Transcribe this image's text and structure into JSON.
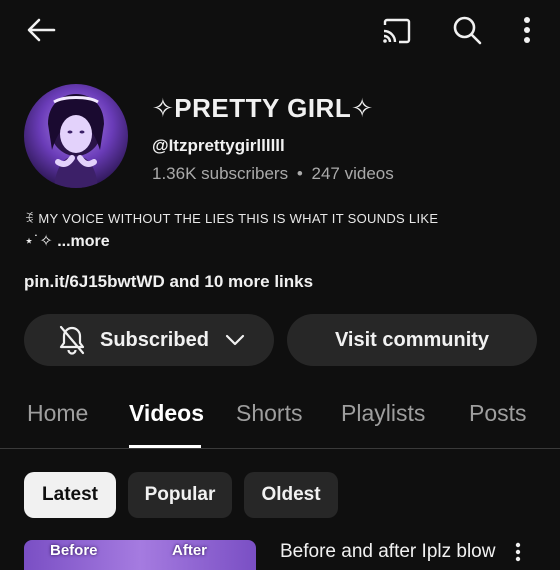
{
  "channel": {
    "name": "✧PRETTY GIRL✧",
    "handle": "@Itzprettygirllllll",
    "subscribers": "1.36K subscribers",
    "separator": "•",
    "videos_count": "247 videos",
    "description_line1": "ꉂ MY VOICE WITHOUT THE LIES THIS IS WHAT IT SOUNDS LIKE",
    "description_line2_prefix": "⋆˙✧ ",
    "description_more": "...more",
    "link_text": "pin.it/6J15bwtWD",
    "more_links": " and 10 more links"
  },
  "actions": {
    "subscribe_label": "Subscribed",
    "community_label": "Visit community"
  },
  "tabs": [
    {
      "label": "Home"
    },
    {
      "label": "Videos",
      "active": true
    },
    {
      "label": "Shorts"
    },
    {
      "label": "Playlists"
    },
    {
      "label": "Posts"
    }
  ],
  "filters": [
    {
      "label": "Latest",
      "selected": true
    },
    {
      "label": "Popular"
    },
    {
      "label": "Oldest"
    }
  ],
  "video": {
    "thumb_left": "Before",
    "thumb_right": "After",
    "title": "Before and after Iplz blow"
  },
  "icons": {
    "back": "back-arrow-icon",
    "cast": "cast-icon",
    "search": "search-icon",
    "menu": "more-vert-icon",
    "bell": "bell-off-icon",
    "chevron": "chevron-down-icon"
  },
  "colors": {
    "background": "#0f0f0f",
    "button_bg": "#272727",
    "secondary_text": "#aaaaaa",
    "chip_selected_bg": "#f1f1f1"
  }
}
